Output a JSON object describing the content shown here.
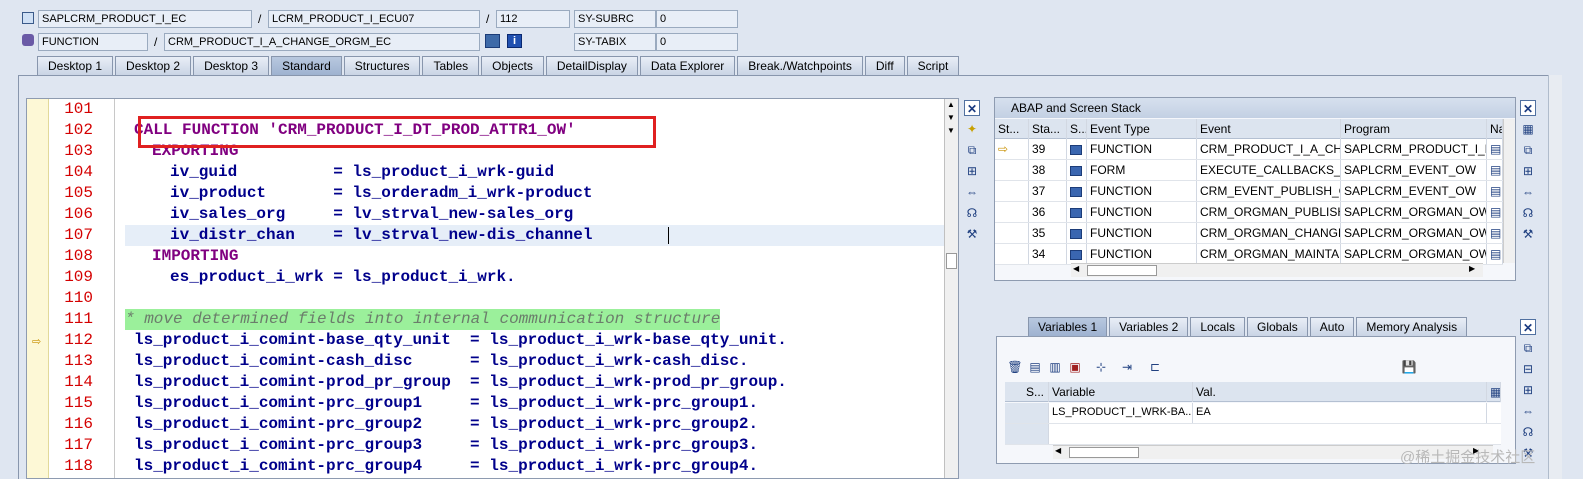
{
  "header": {
    "row1": {
      "program": "SAPLCRM_PRODUCT_I_EC",
      "include": "LCRM_PRODUCT_I_ECU07",
      "line": "112",
      "sysvar": "SY-SUBRC",
      "sysval": "0"
    },
    "row2": {
      "type": "FUNCTION",
      "name": "CRM_PRODUCT_I_A_CHANGE_ORGM_EC",
      "sysvar": "SY-TABIX",
      "sysval": "0"
    },
    "separator": "/"
  },
  "tabs": [
    "Desktop 1",
    "Desktop 2",
    "Desktop 3",
    "Standard",
    "Structures",
    "Tables",
    "Objects",
    "DetailDisplay",
    "Data Explorer",
    "Break./Watchpoints",
    "Diff",
    "Script"
  ],
  "editor": {
    "lines": [
      {
        "n": "101",
        "t": ""
      },
      {
        "n": "102",
        "t": "CALL FUNCTION 'CRM_PRODUCT_I_DT_PROD_ATTR1_OW'"
      },
      {
        "n": "103",
        "t": "EXPORTING"
      },
      {
        "n": "104",
        "t": "iv_guid          = ls_product_i_wrk-guid"
      },
      {
        "n": "105",
        "t": "iv_product       = ls_orderadm_i_wrk-product"
      },
      {
        "n": "106",
        "t": "iv_sales_org     = lv_strval_new-sales_org"
      },
      {
        "n": "107",
        "t": "iv_distr_chan    = lv_strval_new-dis_channel"
      },
      {
        "n": "108",
        "t": "IMPORTING"
      },
      {
        "n": "109",
        "t": "es_product_i_wrk = ls_product_i_wrk."
      },
      {
        "n": "110",
        "t": ""
      },
      {
        "n": "111",
        "t": "* move determined fields into internal communication structure"
      },
      {
        "n": "112",
        "t": "ls_product_i_comint-base_qty_unit  = ls_product_i_wrk-base_qty_unit."
      },
      {
        "n": "113",
        "t": "ls_product_i_comint-cash_disc      = ls_product_i_wrk-cash_disc."
      },
      {
        "n": "114",
        "t": "ls_product_i_comint-prod_pr_group  = ls_product_i_wrk-prod_pr_group."
      },
      {
        "n": "115",
        "t": "ls_product_i_comint-prc_group1     = ls_product_i_wrk-prc_group1."
      },
      {
        "n": "116",
        "t": "ls_product_i_comint-prc_group2     = ls_product_i_wrk-prc_group2."
      },
      {
        "n": "117",
        "t": "ls_product_i_comint-prc_group3     = ls_product_i_wrk-prc_group3."
      },
      {
        "n": "118",
        "t": "ls_product_i_comint-prc_group4     = ls_product_i_wrk-prc_group4."
      }
    ]
  },
  "stack": {
    "title": "ABAP and Screen Stack",
    "columns": [
      "St...",
      "Sta...",
      "S...",
      "Event Type",
      "Event",
      "Program",
      "Na"
    ],
    "rows": [
      {
        "level": "39",
        "type": "FUNCTION",
        "event": "CRM_PRODUCT_I_A_CH...",
        "program": "SAPLCRM_PRODUCT_I_EC"
      },
      {
        "level": "38",
        "type": "FORM",
        "event": "EXECUTE_CALLBACKS_A...",
        "program": "SAPLCRM_EVENT_OW"
      },
      {
        "level": "37",
        "type": "FUNCTION",
        "event": "CRM_EVENT_PUBLISH_O...",
        "program": "SAPLCRM_EVENT_OW"
      },
      {
        "level": "36",
        "type": "FUNCTION",
        "event": "CRM_ORGMAN_PUBLISH...",
        "program": "SAPLCRM_ORGMAN_OW"
      },
      {
        "level": "35",
        "type": "FUNCTION",
        "event": "CRM_ORGMAN_CHANGE...",
        "program": "SAPLCRM_ORGMAN_OW"
      },
      {
        "level": "34",
        "type": "FUNCTION",
        "event": "CRM_ORGMAN_MAINTAI...",
        "program": "SAPLCRM_ORGMAN_OW"
      }
    ]
  },
  "vartabs": [
    "Variables 1",
    "Variables 2",
    "Locals",
    "Globals",
    "Auto",
    "Memory Analysis"
  ],
  "vars": {
    "columns": [
      "S...",
      "Variable",
      "Val."
    ],
    "rows": [
      {
        "name": "LS_PRODUCT_I_WRK-BA...",
        "value": "EA"
      }
    ]
  },
  "watermark": "@稀土掘金技术社区",
  "colors": {
    "accent_red": "#e02020",
    "line_num": "#d40000",
    "comment_bg": "#9bf09b"
  }
}
